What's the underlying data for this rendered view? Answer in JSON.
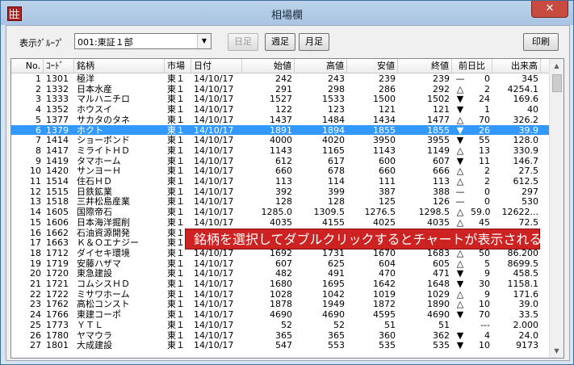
{
  "window": {
    "title": "相場欄"
  },
  "toolbar": {
    "group_label": "表示ｸﾞﾙｰﾌﾟ",
    "group_value": "001:東証１部",
    "prev_week_label": "日足",
    "week_label": "週足",
    "month_label": "月足",
    "print_label": "印刷"
  },
  "columns": [
    "No.",
    "ｺｰﾄﾞ",
    "銘柄",
    "市場",
    "日付",
    "始値",
    "高値",
    "安値",
    "終値",
    "前日比",
    "出来高"
  ],
  "selected_row": 5,
  "rows": [
    [
      "1",
      "1301",
      "極洋",
      "東１",
      "14/10/17",
      "242",
      "243",
      "239",
      "239",
      "—",
      "0",
      "345"
    ],
    [
      "2",
      "1332",
      "日本水産",
      "東１",
      "14/10/17",
      "291",
      "298",
      "286",
      "292",
      "△",
      "2",
      "4254.1"
    ],
    [
      "3",
      "1333",
      "マルハニチロ",
      "東１",
      "14/10/17",
      "1527",
      "1533",
      "1500",
      "1502",
      "▼",
      "24",
      "169.6"
    ],
    [
      "4",
      "1352",
      "ホウスイ",
      "東１",
      "14/10/17",
      "122",
      "123",
      "121",
      "121",
      "▼",
      "1",
      "40"
    ],
    [
      "5",
      "1377",
      "サカタのタネ",
      "東１",
      "14/10/17",
      "1437",
      "1484",
      "1434",
      "1477",
      "△",
      "70",
      "326.2"
    ],
    [
      "6",
      "1379",
      "ホクト",
      "東１",
      "14/10/17",
      "1891",
      "1894",
      "1855",
      "1855",
      "▼",
      "26",
      "39.9"
    ],
    [
      "7",
      "1414",
      "ショーボンド",
      "東１",
      "14/10/17",
      "4000",
      "4020",
      "3950",
      "3955",
      "▼",
      "55",
      "128.0"
    ],
    [
      "8",
      "1417",
      "ミライトＨＤ",
      "東１",
      "14/10/17",
      "1143",
      "1165",
      "1143",
      "1149",
      "△",
      "13",
      "330.9"
    ],
    [
      "9",
      "1419",
      "タマホーム",
      "東１",
      "14/10/17",
      "612",
      "617",
      "600",
      "607",
      "▼",
      "11",
      "146.7"
    ],
    [
      "10",
      "1420",
      "サンヨーＨ",
      "東１",
      "14/10/17",
      "660",
      "678",
      "660",
      "666",
      "△",
      "2",
      "27.5"
    ],
    [
      "11",
      "1514",
      "住石ＨＤ",
      "東１",
      "14/10/17",
      "113",
      "114",
      "111",
      "113",
      "△",
      "2",
      "612.5"
    ],
    [
      "12",
      "1515",
      "日鉄鉱業",
      "東１",
      "14/10/17",
      "392",
      "399",
      "387",
      "388",
      "—",
      "0",
      "297"
    ],
    [
      "13",
      "1518",
      "三井松島産業",
      "東１",
      "14/10/17",
      "128",
      "128",
      "125",
      "126",
      "—",
      "0",
      "530"
    ],
    [
      "14",
      "1605",
      "国際帝石",
      "東１",
      "14/10/17",
      "1285.0",
      "1309.5",
      "1276.5",
      "1298.5",
      "△",
      "59.0",
      "12622..."
    ],
    [
      "15",
      "1606",
      "日本海洋掘削",
      "東１",
      "14/10/17",
      "4035",
      "4155",
      "4025",
      "4035",
      "△",
      "45",
      "72.5"
    ],
    [
      "16",
      "1662",
      "石油資源開発",
      "東１",
      "14/10/17",
      "",
      "",
      "",
      "",
      "",
      "",
      ""
    ],
    [
      "17",
      "1663",
      "Ｋ＆Ｏエナジー",
      "東１",
      "14/10/17",
      "",
      "",
      "",
      "",
      "",
      "",
      ""
    ],
    [
      "18",
      "1712",
      "ダイセキ環境",
      "東１",
      "14/10/17",
      "1692",
      "1731",
      "1670",
      "1683",
      "△",
      "50",
      "86.200"
    ],
    [
      "19",
      "1719",
      "安藤ハザマ",
      "東１",
      "14/10/17",
      "607",
      "625",
      "604",
      "605",
      "△",
      "5",
      "8699.5"
    ],
    [
      "20",
      "1720",
      "東急建設",
      "東１",
      "14/10/17",
      "482",
      "491",
      "470",
      "471",
      "▼",
      "9",
      "458.5"
    ],
    [
      "21",
      "1721",
      "コムシスＨＤ",
      "東１",
      "14/10/17",
      "1680",
      "1695",
      "1642",
      "1648",
      "▼",
      "30",
      "1158.1"
    ],
    [
      "22",
      "1722",
      "ミサワホーム",
      "東１",
      "14/10/17",
      "1028",
      "1042",
      "1019",
      "1029",
      "△",
      "9",
      "171.6"
    ],
    [
      "23",
      "1762",
      "高松コンスト",
      "東１",
      "14/10/17",
      "1878",
      "1949",
      "1872",
      "1890",
      "△",
      "10",
      "39.0"
    ],
    [
      "24",
      "1766",
      "東建コーポ",
      "東１",
      "14/10/17",
      "4690",
      "4690",
      "4595",
      "4690",
      "▼",
      "70",
      "33.5"
    ],
    [
      "25",
      "1773",
      "ＹＴＬ",
      "東１",
      "14/10/17",
      "52",
      "52",
      "51",
      "51",
      "",
      "---",
      "2.000"
    ],
    [
      "26",
      "1780",
      "ヤマウラ",
      "東１",
      "14/10/17",
      "365",
      "365",
      "360",
      "362",
      "▼",
      "4",
      "24.0"
    ],
    [
      "27",
      "1801",
      "大成建設",
      "東１",
      "14/10/17",
      "547",
      "553",
      "535",
      "535",
      "▼",
      "10",
      "9173"
    ]
  ],
  "annotation": "銘柄を選択してダブルクリックするとチャートが表示される"
}
